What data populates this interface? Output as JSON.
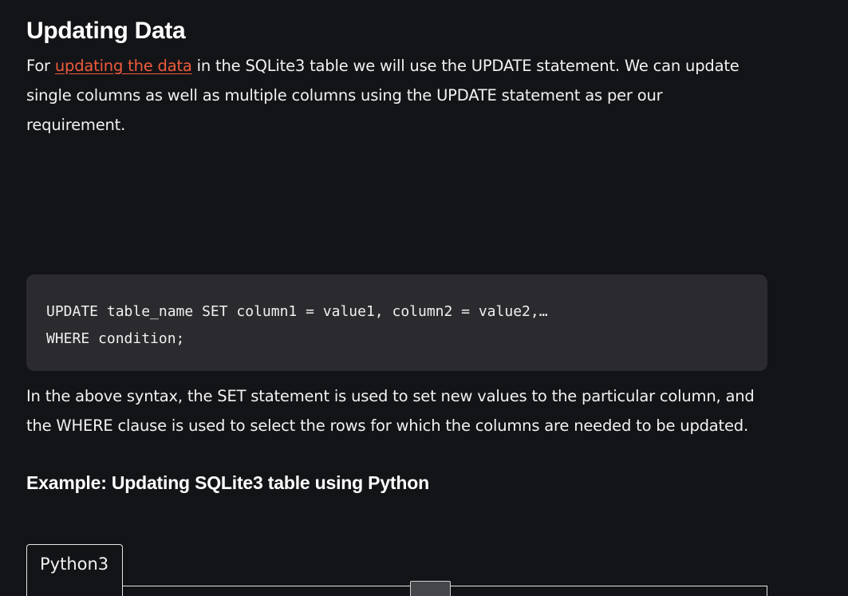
{
  "section": {
    "title": "Updating Data"
  },
  "intro": {
    "prefix": "For ",
    "link_text": "updating the data",
    "suffix": " in the SQLite3 table we will use the UPDATE statement. We can update single columns as well as multiple columns using the UPDATE statement as per our requirement."
  },
  "code": {
    "lines": [
      "UPDATE table_name SET column1 = value1, column2 = value2,…",
      "WHERE condition;"
    ]
  },
  "explanation": {
    "text": "In the above syntax, the SET statement is used to set new values to the particular column, and the WHERE clause is used to select the rows for which the columns are needed to be updated."
  },
  "example": {
    "title": "Example: Updating SQLite3 table using Python"
  },
  "code_tabs": {
    "active_tab": "Python3"
  },
  "colors": {
    "background": "#131417",
    "code_background": "#2b2b2f",
    "link": "#ef5b3d"
  }
}
